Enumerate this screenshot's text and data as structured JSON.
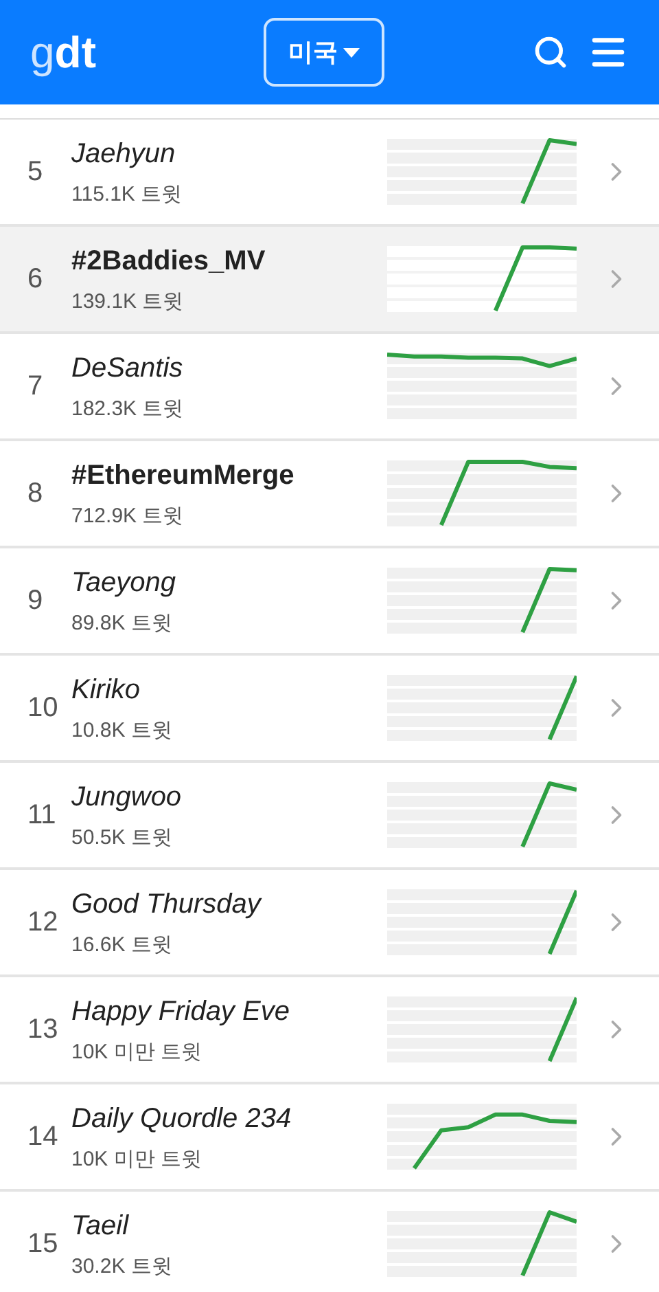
{
  "header": {
    "logo_light": "g",
    "logo_bold": "dt",
    "country": "미국"
  },
  "trends": [
    {
      "rank": "5",
      "name": "Jaehyun",
      "kind": "keyword",
      "count": "115.1K 트윗",
      "selected": false
    },
    {
      "rank": "6",
      "name": "#2Baddies_MV",
      "kind": "hashtag",
      "count": "139.1K 트윗",
      "selected": true
    },
    {
      "rank": "7",
      "name": "DeSantis",
      "kind": "keyword",
      "count": "182.3K 트윗",
      "selected": false
    },
    {
      "rank": "8",
      "name": "#EthereumMerge",
      "kind": "hashtag",
      "count": "712.9K 트윗",
      "selected": false
    },
    {
      "rank": "9",
      "name": "Taeyong",
      "kind": "keyword",
      "count": "89.8K 트윗",
      "selected": false
    },
    {
      "rank": "10",
      "name": "Kiriko",
      "kind": "keyword",
      "count": "10.8K 트윗",
      "selected": false
    },
    {
      "rank": "11",
      "name": "Jungwoo",
      "kind": "keyword",
      "count": "50.5K 트윗",
      "selected": false
    },
    {
      "rank": "12",
      "name": "Good Thursday",
      "kind": "keyword",
      "count": "16.6K 트윗",
      "selected": false
    },
    {
      "rank": "13",
      "name": "Happy Friday Eve",
      "kind": "keyword",
      "count": "10K 미만 트윗",
      "selected": false
    },
    {
      "rank": "14",
      "name": "Daily Quordle 234",
      "kind": "keyword",
      "count": "10K 미만 트윗",
      "selected": false
    },
    {
      "rank": "15",
      "name": "Taeil",
      "kind": "keyword",
      "count": "30.2K 트윗",
      "selected": false
    }
  ]
}
